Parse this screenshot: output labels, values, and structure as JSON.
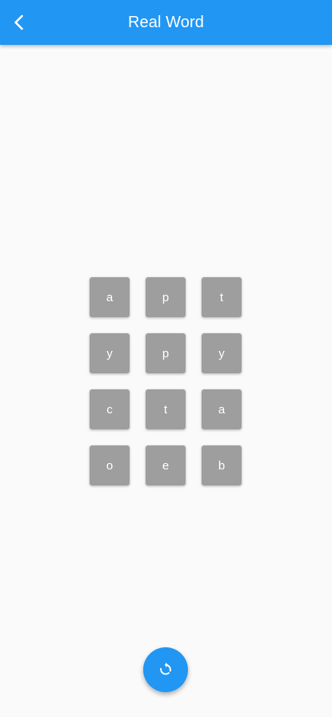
{
  "appbar": {
    "title": "Real Word",
    "back_icon": "chevron-left-icon",
    "color": "#2196f3"
  },
  "tiles": [
    {
      "letter": "a"
    },
    {
      "letter": "p"
    },
    {
      "letter": "t"
    },
    {
      "letter": "y"
    },
    {
      "letter": "p"
    },
    {
      "letter": "y"
    },
    {
      "letter": "c"
    },
    {
      "letter": "t"
    },
    {
      "letter": "a"
    },
    {
      "letter": "o"
    },
    {
      "letter": "e"
    },
    {
      "letter": "b"
    }
  ],
  "tile_color": "#9e9e9e",
  "fab": {
    "icon": "refresh-icon",
    "color": "#2196f3"
  }
}
